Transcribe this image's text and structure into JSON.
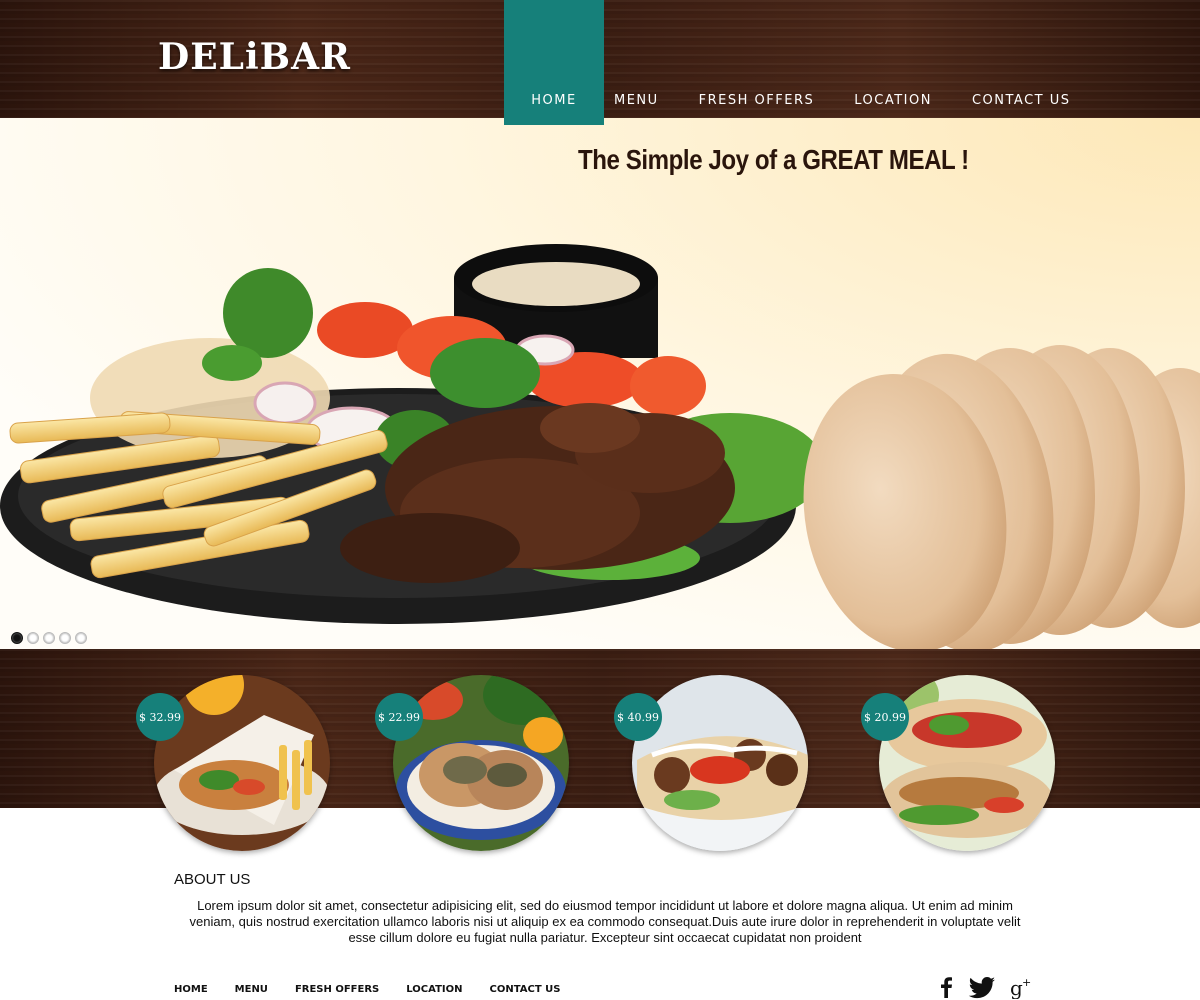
{
  "brand": {
    "name": "DELiBAR"
  },
  "nav": {
    "items": [
      {
        "label": "HOME",
        "active": true
      },
      {
        "label": "MENU"
      },
      {
        "label": "FRESH OFFERS"
      },
      {
        "label": "LOCATION"
      },
      {
        "label": "CONTACT US"
      }
    ]
  },
  "hero": {
    "title": "The  Simple Joy of a GREAT MEAL !",
    "slides": {
      "count": 5,
      "active": 1
    }
  },
  "products": [
    {
      "price": "$ 32.99"
    },
    {
      "price": "$ 22.99"
    },
    {
      "price": "$ 40.99"
    },
    {
      "price": "$ 20.99"
    }
  ],
  "about": {
    "title": "ABOUT US",
    "text": "Lorem ipsum dolor sit amet, consectetur adipisicing elit, sed do eiusmod tempor incididunt ut labore et dolore magna aliqua. Ut enim ad minim veniam, quis nostrud exercitation ullamco laboris nisi ut aliquip ex ea commodo consequat.Duis aute irure dolor in reprehenderit in voluptate velit esse cillum dolore eu fugiat nulla pariatur. Excepteur sint occaecat cupidatat non proident"
  },
  "footer": {
    "links": [
      "HOME",
      "MENU",
      "FRESH OFFERS",
      "LOCATION",
      "CONTACT US"
    ],
    "social": [
      {
        "icon": "facebook-icon"
      },
      {
        "icon": "twitter-icon"
      },
      {
        "icon": "google-plus-icon"
      }
    ]
  },
  "colors": {
    "accent": "#16807a",
    "wood": "#3a1d12",
    "title": "#2a150c"
  }
}
